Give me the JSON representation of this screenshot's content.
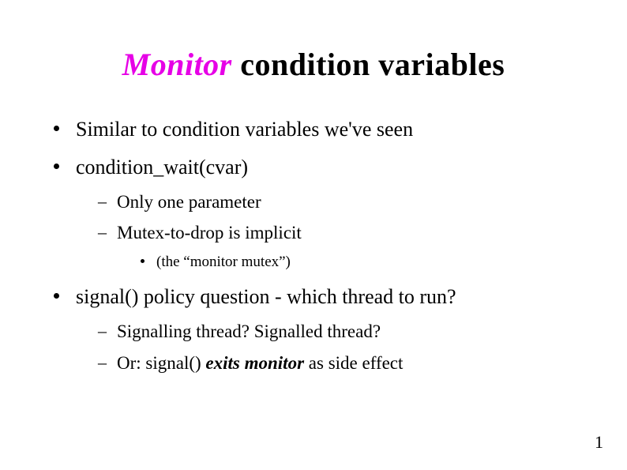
{
  "title": {
    "accent": "Monitor",
    "rest": " condition variables"
  },
  "bullets": {
    "b1": "Similar to condition variables we've seen",
    "b2": "condition_wait(cvar)",
    "b2_sub": {
      "s1": "Only one parameter",
      "s2": "Mutex-to-drop is implicit",
      "s2_sub": {
        "t1": "(the “monitor mutex”)"
      }
    },
    "b3": "signal() policy question - which thread to run?",
    "b3_sub": {
      "s1": "Signalling thread? Signalled thread?",
      "s2_pre": "Or: signal() ",
      "s2_em": "exits monitor",
      "s2_post": " as side effect"
    }
  },
  "page_number": "1"
}
